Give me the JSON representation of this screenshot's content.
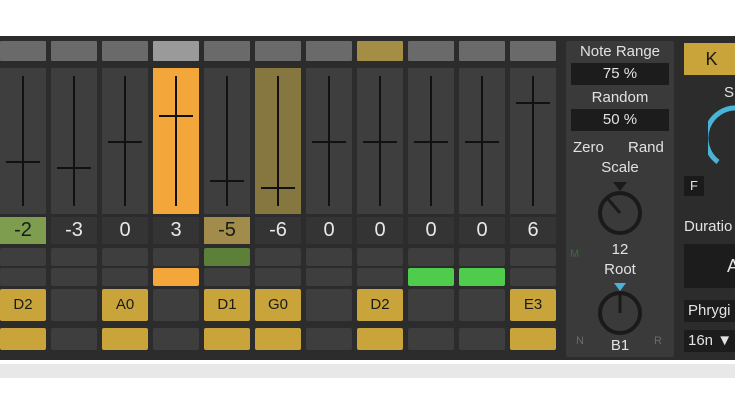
{
  "steps": [
    {
      "value": "-2",
      "note": "D2",
      "fill": 0.35,
      "track": "normal",
      "valstyle": "green",
      "gate": "none",
      "gold_bottom": true
    },
    {
      "value": "-3",
      "note": "",
      "fill": 0.3,
      "track": "normal",
      "valstyle": "normal",
      "gate": "none",
      "gold_bottom": false
    },
    {
      "value": "0",
      "note": "A0",
      "fill": 0.5,
      "track": "normal",
      "valstyle": "normal",
      "gate": "none",
      "gold_bottom": true
    },
    {
      "value": "3",
      "note": "",
      "fill": 0.7,
      "track": "selected",
      "valstyle": "normal",
      "gate": "orange",
      "gold_bottom": false
    },
    {
      "value": "-5",
      "note": "D1",
      "fill": 0.2,
      "track": "normal",
      "valstyle": "olive",
      "gate": "darkgreen",
      "gold_bottom": true
    },
    {
      "value": "-6",
      "note": "G0",
      "fill": 0.15,
      "track": "dim",
      "valstyle": "normal",
      "gate": "none",
      "gold_bottom": true
    },
    {
      "value": "0",
      "note": "",
      "fill": 0.5,
      "track": "normal",
      "valstyle": "normal",
      "gate": "none",
      "gold_bottom": false
    },
    {
      "value": "0",
      "note": "D2",
      "fill": 0.5,
      "track": "normal",
      "valstyle": "normal",
      "gate": "none",
      "gold_bottom": true
    },
    {
      "value": "0",
      "note": "",
      "fill": 0.5,
      "track": "normal",
      "valstyle": "normal",
      "gate": "brightgreen",
      "gold_bottom": false
    },
    {
      "value": "0",
      "note": "",
      "fill": 0.5,
      "track": "normal",
      "valstyle": "normal",
      "gate": "brightgreen",
      "gold_bottom": false
    },
    {
      "value": "6",
      "note": "E3",
      "fill": 0.8,
      "track": "normal",
      "valstyle": "normal",
      "gate": "none",
      "gold_bottom": true
    }
  ],
  "panel": {
    "note_range_label": "Note Range",
    "note_range_value": "75 %",
    "random_label": "Random",
    "random_value": "50 %",
    "zero_label": "Zero",
    "rand_label": "Rand",
    "scale_label": "Scale",
    "scale_value": "12",
    "root_label": "Root",
    "root_value": "B1",
    "m_label": "M",
    "n_label": "N",
    "r_label": "R"
  },
  "right": {
    "top_button": "K",
    "s_label": "S",
    "f_button": "F",
    "duration_label": "Duratio",
    "a_label": "A",
    "mode_value": "Phrygi",
    "rate_value": "16n ▼"
  },
  "colors": {
    "accent_orange": "#f3a73a",
    "gold": "#c9a43a",
    "green": "#4fcc4c",
    "knob_arc": "#4ab4d8"
  }
}
